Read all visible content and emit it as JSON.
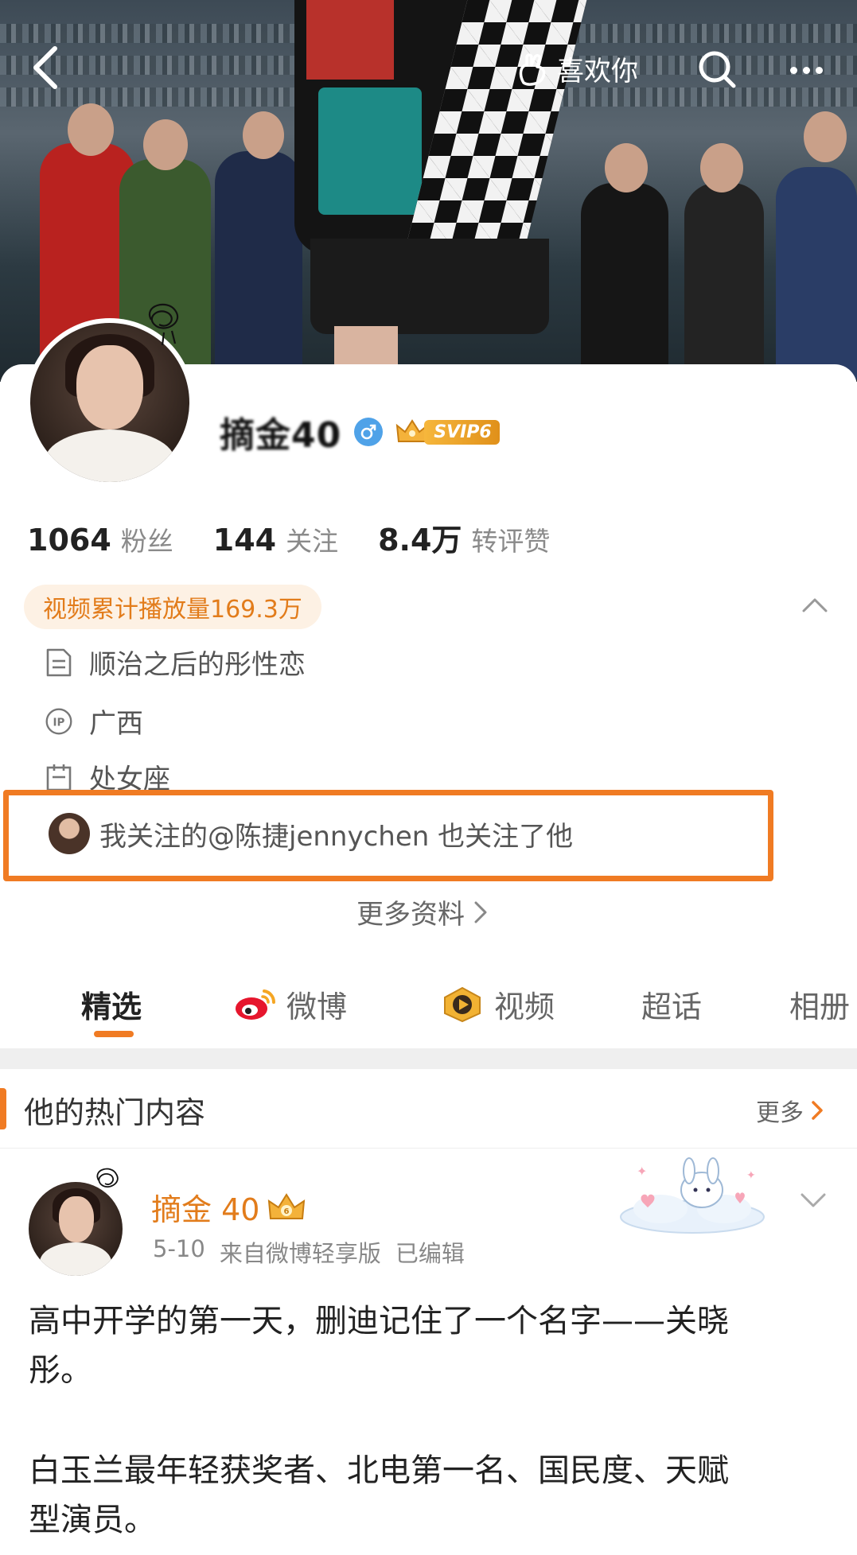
{
  "topbar": {
    "like_you_label": "喜欢你"
  },
  "profile": {
    "name": "摘金40",
    "svip_label": "SVIP6",
    "stats": [
      {
        "num": "1064",
        "label": "粉丝"
      },
      {
        "num": "144",
        "label": "关注"
      },
      {
        "num": "8.4万",
        "label": "转评赞"
      }
    ],
    "video_views": "视频累计播放量169.3万",
    "bio": "顺治之后的彤性恋",
    "ip_location": "广西",
    "zodiac": "处女座",
    "mutual_follow": "我关注的@陈捷jennychen 也关注了他",
    "more_info": "更多资料"
  },
  "tabs": [
    {
      "label": "精选",
      "icon": "none"
    },
    {
      "label": "微博",
      "icon": "weibo-icon"
    },
    {
      "label": "视频",
      "icon": "video-icon"
    },
    {
      "label": "超话",
      "icon": "none"
    },
    {
      "label": "相册",
      "icon": "none"
    }
  ],
  "hot": {
    "title": "他的热门内容",
    "more": "更多"
  },
  "post": {
    "author": "摘金 40",
    "date": "5-10",
    "source": "来自微博轻享版",
    "edited": "已编辑",
    "paragraph1_line1": "高中开学的第一天，删迪记住了一个名字——关晓",
    "paragraph1_line2": "彤。",
    "paragraph2_line1": "白玉兰最年轻获奖者、北电第一名、国民度、天赋",
    "paragraph2_line2": "型演员。"
  },
  "colors": {
    "accent": "#f07b23",
    "name_orange": "#e27c1b",
    "pill_bg": "#fdf1e4",
    "gender_blue": "#4fa2e8"
  }
}
